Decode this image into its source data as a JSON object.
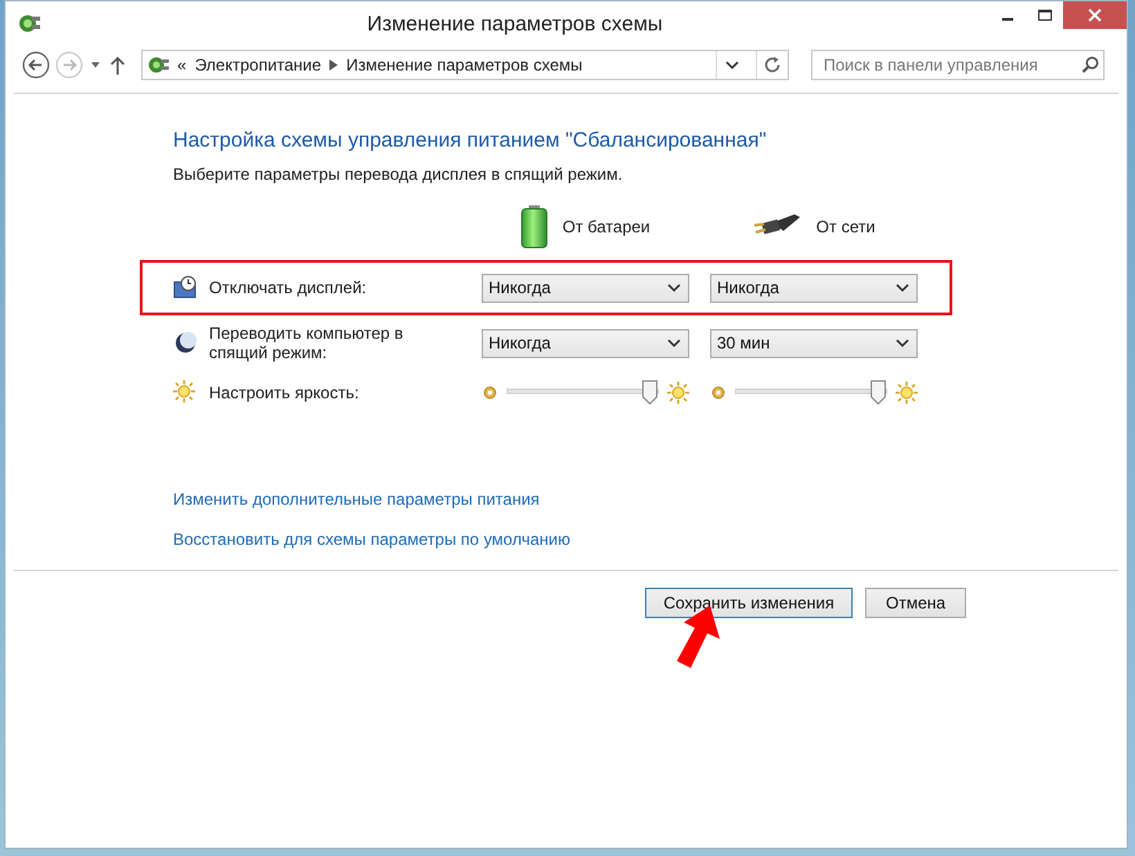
{
  "window": {
    "title": "Изменение параметров схемы"
  },
  "nav": {
    "prefix": "«",
    "breadcrumbs": [
      "Электропитание",
      "Изменение параметров схемы"
    ],
    "search": {
      "placeholder": "Поиск в панели управления"
    }
  },
  "heading": "Настройка схемы управления питанием \"Сбалансированная\"",
  "subheading": "Выберите параметры перевода дисплея в спящий режим.",
  "columns": [
    {
      "kind": "battery",
      "label": "От батареи"
    },
    {
      "kind": "plug",
      "label": "От сети"
    }
  ],
  "settings": [
    {
      "kind": "dropdown",
      "label": "Отключать дисплей:",
      "highlighted": true,
      "values": [
        "Никогда",
        "Никогда"
      ]
    },
    {
      "kind": "dropdown",
      "label": "Переводить компьютер в спящий режим:",
      "highlighted": false,
      "values": [
        "Никогда",
        "30 мин"
      ]
    },
    {
      "kind": "slider",
      "label": "Настроить яркость:",
      "highlighted": false,
      "sliders": [
        {
          "level": 0.97
        },
        {
          "level": 0.97
        }
      ]
    }
  ],
  "links": [
    "Изменить дополнительные параметры питания",
    "Восстановить для схемы параметры по умолчанию"
  ],
  "buttons": [
    {
      "label": "Сохранить изменения",
      "default": true
    },
    {
      "label": "Отмена",
      "default": false
    }
  ],
  "annotations": [
    {
      "kind": "arrow"
    }
  ]
}
